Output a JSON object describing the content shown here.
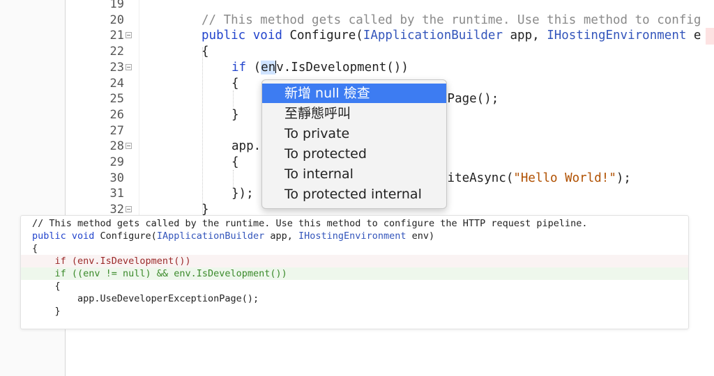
{
  "editor": {
    "gutter": [
      "19",
      "20",
      "21",
      "22",
      "23",
      "24",
      "25",
      "26",
      "27",
      "28",
      "29",
      "30",
      "31",
      "32"
    ],
    "lines": {
      "l20": "// This method gets called by the runtime. Use this method to config",
      "l21_kw": "public void ",
      "l21_fn": "Configure(",
      "l21_t1": "IApplicationBuilder",
      "l21_mid": " app, ",
      "l21_t2": "IHostingEnvironment",
      "l21_tail": " e",
      "l22": "{",
      "l23_if": "if ",
      "l23_paren": "(",
      "l23_sel": "en",
      "l23_rest": "v.IsDevelopment())",
      "l24": "{",
      "l25": "nPage();",
      "l26": "}",
      "l28": "app.",
      "l29": "{",
      "l30_pre": "riteAsync(",
      "l30_str": "\"Hello World!\"",
      "l30_post": ");",
      "l31": "});",
      "l32": "}"
    }
  },
  "context_menu": {
    "items": [
      {
        "label": "新增 null 檢查"
      },
      {
        "label": "至靜態呼叫"
      },
      {
        "label": "To private"
      },
      {
        "label": "To protected"
      },
      {
        "label": "To internal"
      },
      {
        "label": "To protected internal"
      }
    ]
  },
  "preview": {
    "lines": [
      "// This method gets called by the runtime. Use this method to configure the HTTP request pipeline.",
      "public void Configure(IApplicationBuilder app, IHostingEnvironment env)",
      "{",
      "    if (env.IsDevelopment())",
      "    if ((env != null) && env.IsDevelopment())",
      "    {",
      "        app.UseDeveloperExceptionPage();",
      "    }"
    ]
  },
  "colors": {
    "highlight": "#3d7cf2",
    "keyword": "#2244cc",
    "string": "#b05000",
    "removed_text": "#9b2a2a",
    "added_text": "#3a8a2a"
  }
}
